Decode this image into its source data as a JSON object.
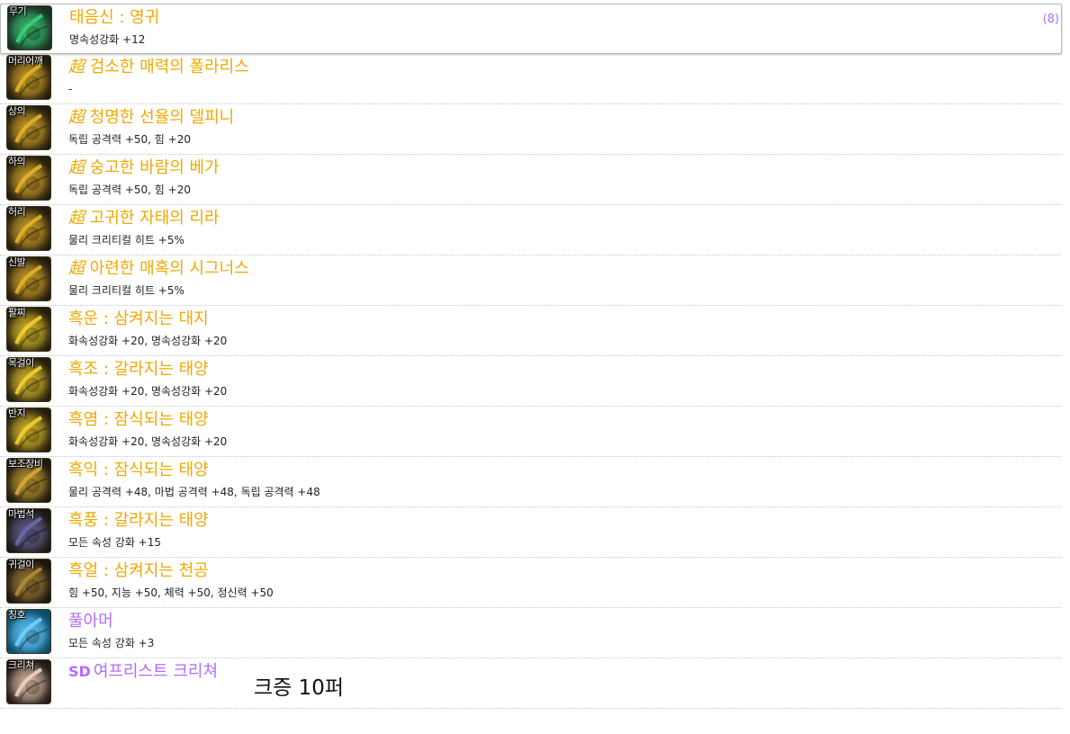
{
  "items": [
    {
      "slot": "무기",
      "name": "태음신 : 영귀",
      "desc": "명속성강화 +12",
      "count": "(8)",
      "name_color": "#f0a800",
      "icon": "sword-icon",
      "icon_bg": "#1e3b2c",
      "icon_fg": "#3ad07a"
    },
    {
      "slot": "머리어깨",
      "prefix": "超",
      "name": "검소한 매력의 폴라리스",
      "desc": "-",
      "name_color": "#f0a800",
      "icon": "shoulder-armor-icon",
      "icon_bg": "#2b2210",
      "icon_fg": "#e4b22a"
    },
    {
      "slot": "상의",
      "prefix": "超",
      "name": "청명한 선율의 델피니",
      "desc": "독립 공격력 +50, 힘 +20",
      "name_color": "#f0a800",
      "icon": "top-armor-icon",
      "icon_bg": "#2b2210",
      "icon_fg": "#e4b22a"
    },
    {
      "slot": "하의",
      "prefix": "超",
      "name": "숭고한 바람의 베가",
      "desc": "독립 공격력 +50, 힘 +20",
      "name_color": "#f0a800",
      "icon": "bottom-armor-icon",
      "icon_bg": "#2b2210",
      "icon_fg": "#e4b22a"
    },
    {
      "slot": "허리",
      "prefix": "超",
      "name": "고귀한 자태의 리라",
      "desc": "물리 크리티컬 히트 +5%",
      "name_color": "#f0a800",
      "icon": "belt-icon",
      "icon_bg": "#2b2210",
      "icon_fg": "#e4b22a"
    },
    {
      "slot": "신발",
      "prefix": "超",
      "name": "아련한 매혹의 시그너스",
      "desc": "물리 크리티컬 히트 +5%",
      "name_color": "#f0a800",
      "icon": "shoes-icon",
      "icon_bg": "#2b2210",
      "icon_fg": "#e4b22a"
    },
    {
      "slot": "팔찌",
      "name": "흑운 : 삼켜지는 대지",
      "desc": "화속성강화 +20, 명속성강화 +20",
      "name_color": "#f0a800",
      "icon": "bracelet-icon",
      "icon_bg": "#2a2410",
      "icon_fg": "#f3cf2e"
    },
    {
      "slot": "목걸이",
      "name": "흑조 : 갈라지는 태양",
      "desc": "화속성강화 +20, 명속성강화 +20",
      "name_color": "#f0a800",
      "icon": "necklace-icon",
      "icon_bg": "#2a2410",
      "icon_fg": "#f3cf2e"
    },
    {
      "slot": "반지",
      "name": "흑염 : 잠식되는 태양",
      "desc": "화속성강화 +20, 명속성강화 +20",
      "name_color": "#f0a800",
      "icon": "ring-icon",
      "icon_bg": "#2a2410",
      "icon_fg": "#f3cf2e"
    },
    {
      "slot": "보조장비",
      "name": "흑익 : 잠식되는 태양",
      "desc": "물리 공격력 +48, 마법 공격력 +48, 독립 공격력 +48",
      "name_color": "#f0a800",
      "icon": "sub-equipment-icon",
      "icon_bg": "#241f12",
      "icon_fg": "#d6aa36"
    },
    {
      "slot": "마법석",
      "name": "흑풍 : 갈라지는 태양",
      "desc": "모든 속성 강화 +15",
      "name_color": "#f0a800",
      "icon": "magic-stone-icon",
      "icon_bg": "#221c14",
      "icon_fg": "#6a6aa8"
    },
    {
      "slot": "귀걸이",
      "name": "흑얼 : 삼켜지는 천공",
      "desc": "힘 +50, 지능 +50, 체력 +50, 정신력 +50",
      "name_color": "#f0a800",
      "icon": "earring-icon",
      "icon_bg": "#201a10",
      "icon_fg": "#b08a3a"
    },
    {
      "slot": "칭호",
      "name": "풀아머",
      "desc": "모든 속성 강화 +3",
      "name_color": "#b36bff",
      "icon": "title-icon",
      "icon_bg": "#0e5e84",
      "icon_fg": "#6fd0ff"
    },
    {
      "slot": "크리쳐",
      "prefix_sd": "SD",
      "name": "여프리스트 크리쳐",
      "desc": "",
      "name_color": "#b36bff",
      "icon": "creature-icon",
      "icon_bg": "#2a1e1a",
      "icon_fg": "#f1d2bc"
    }
  ],
  "note": "크증 10퍼"
}
